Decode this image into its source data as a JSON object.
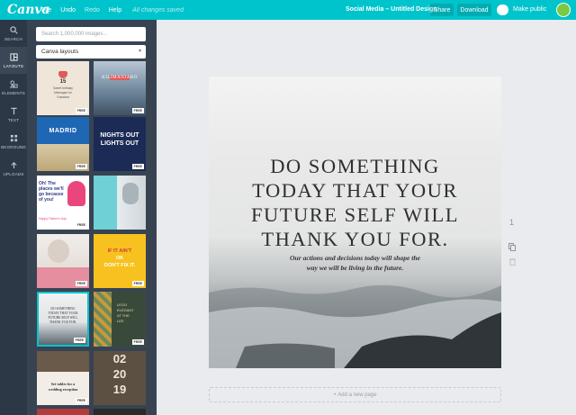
{
  "app": {
    "logo": "Canva",
    "menu": [
      "File",
      "Undo",
      "Redo",
      "Help"
    ],
    "status": "All changes saved",
    "doc_title": "Social Media – Untitled Design",
    "share_label": "Share",
    "download_label": "Download",
    "public_label": "Make public"
  },
  "rail": [
    {
      "label": "SEARCH",
      "icon": "search-icon"
    },
    {
      "label": "LAYOUTS",
      "icon": "layouts-icon",
      "active": true
    },
    {
      "label": "ELEMENTS",
      "icon": "elements-icon"
    },
    {
      "label": "TEXT",
      "icon": "text-icon"
    },
    {
      "label": "BKGROUND",
      "icon": "background-icon"
    },
    {
      "label": "UPLOADS",
      "icon": "uploads-icon"
    }
  ],
  "panel": {
    "search_placeholder": "Search 1,000,000 images...",
    "layout_select": "Canva layouts",
    "free_badge": "FREE",
    "thumbs": [
      {
        "lines": [
          "15",
          "Sweet birthday",
          "Messages for",
          "Grandma"
        ]
      },
      {
        "lines": [
          "KILIMANJARO"
        ]
      },
      {
        "lines": [
          "MADRID"
        ]
      },
      {
        "lines": [
          "NIGHTS OUT",
          "LIGHTS OUT"
        ]
      },
      {
        "lines": [
          "Oh! The",
          "places we'll",
          "go because",
          "of you!",
          "Happy Father's Day"
        ]
      },
      {
        "lines": []
      },
      {
        "lines": []
      },
      {
        "lines": [
          "IF IT AIN'T",
          "OK",
          "DON'T FIX IT."
        ]
      },
      {
        "lines": [
          "DO SOMETHING",
          "TODAY THAT YOUR",
          "FUTURE SELF WILL",
          "THANK YOU FOR."
        ]
      },
      {
        "lines": [
          "LEGO",
          "ELEGANT",
          "AT THE",
          "LEE"
        ]
      },
      {
        "lines": [
          "Set tables for a",
          "wedding reception"
        ]
      },
      {
        "lines": [
          "02",
          "20",
          "19"
        ]
      }
    ]
  },
  "design": {
    "headline": [
      "DO SOMETHING",
      "TODAY THAT YOUR",
      "FUTURE SELF WILL",
      "THANK YOU FOR."
    ],
    "subline": [
      "Our actions and decisions today will shape the",
      "way we will be living in the future."
    ]
  },
  "add_page": "+ Add a new page",
  "page_number": "1",
  "colors": {
    "brand": "#00c4cc",
    "rail": "#2d3846",
    "panel": "#384352"
  }
}
